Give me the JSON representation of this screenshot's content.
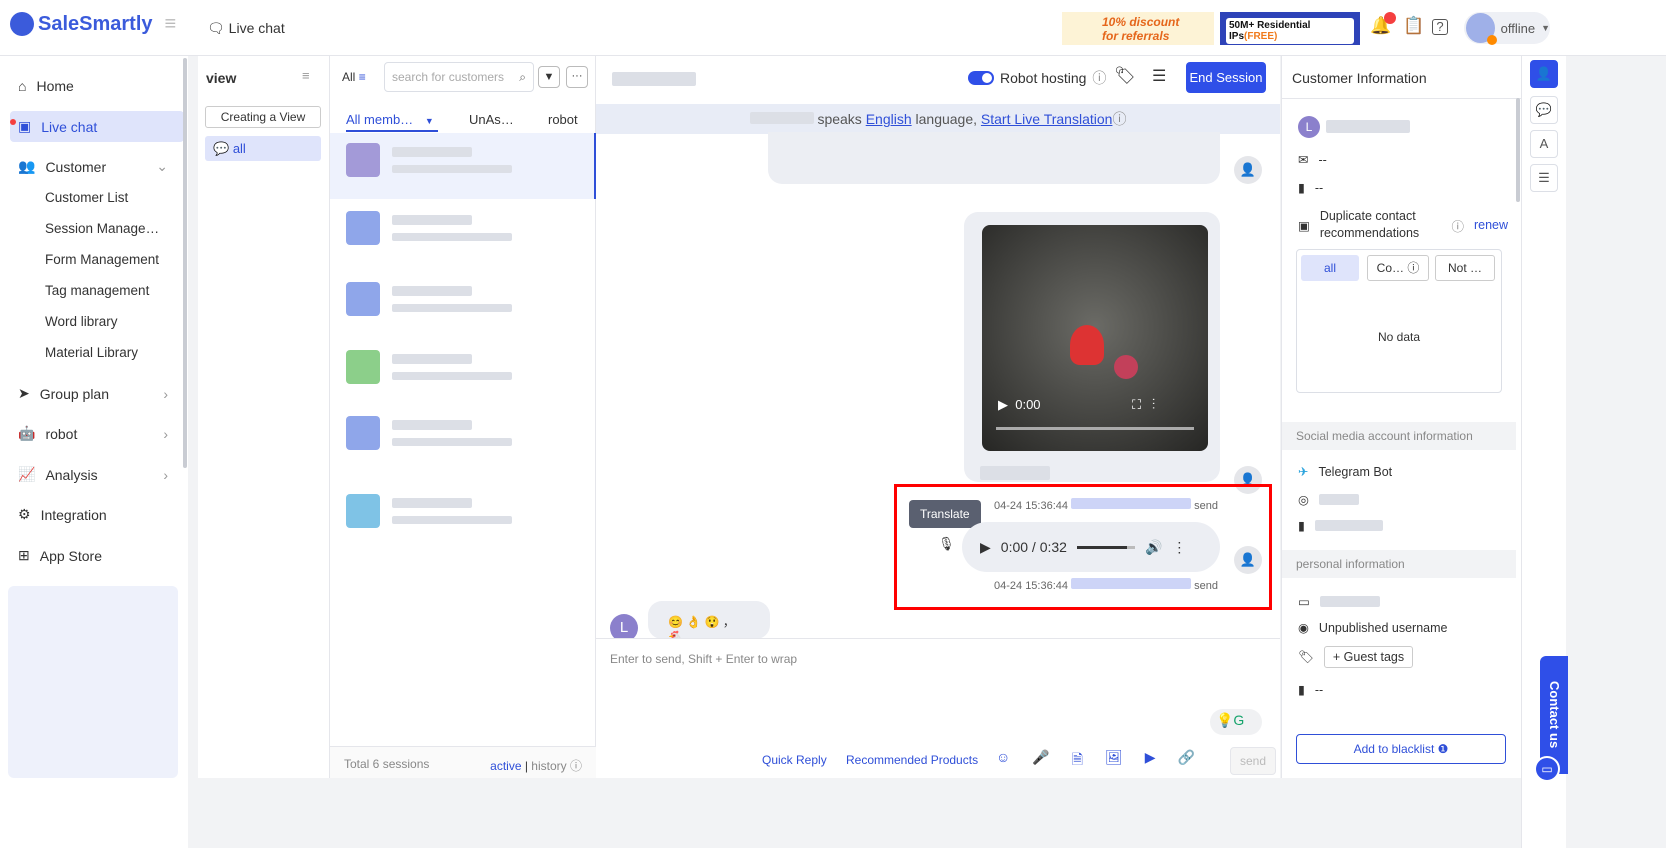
{
  "brand": "SaleSmartly",
  "header": {
    "page_title": "Live chat",
    "promo1_line1": "10% discount",
    "promo1_line2": "for referrals",
    "promo2_text": "50M+ Residential IPs",
    "promo2_free": "(FREE)",
    "notif_badge": "...",
    "status": "offline"
  },
  "sidebar": {
    "items": [
      {
        "label": "Home"
      },
      {
        "label": "Live chat"
      },
      {
        "label": "Customer"
      },
      {
        "label": "Group plan"
      },
      {
        "label": "robot"
      },
      {
        "label": "Analysis"
      },
      {
        "label": "Integration"
      },
      {
        "label": "App Store"
      }
    ],
    "customer_sub": [
      "Customer List",
      "Session Manage…",
      "Form Management",
      "Tag management",
      "Word library",
      "Material Library"
    ]
  },
  "view": {
    "title": "view",
    "create_label": "Creating a View",
    "all_label": "all"
  },
  "list": {
    "filter_all": "All",
    "search_placeholder": "search for customers",
    "tabs": [
      "All memb…",
      "UnAs…",
      "robot"
    ],
    "total": "Total 6 sessions",
    "active": "active",
    "history": "history"
  },
  "chat": {
    "robot_hosting": "Robot hosting",
    "end_session": "End Session",
    "translate_bar": {
      "speaks": "speaks",
      "language": "English",
      "suffix": "language,",
      "action": "Start Live Translation"
    },
    "video_time": "0:00",
    "tooltip": "Translate",
    "audio_time": "0:00 / 0:32",
    "messages": [
      {
        "time": "04-24 15:36:44",
        "status": "send"
      },
      {
        "time": "04-24 15:36:44",
        "status": "send"
      }
    ],
    "emoji_msg": "😊 👌 😲 ， 🐔",
    "avatar_letter": "L",
    "input_placeholder": "Enter to send, Shift + Enter to wrap",
    "toolbar": {
      "quick_reply": "Quick Reply",
      "recommended": "Recommended Products",
      "send": "send"
    }
  },
  "customer": {
    "title": "Customer Information",
    "avatar_letter": "L",
    "email": "--",
    "phone": "--",
    "duplicate": "Duplicate contact recommendations",
    "renew": "renew",
    "dup_tabs": [
      "all",
      "Co…",
      "Not …"
    ],
    "no_data": "No data",
    "social_title": "Social media account information",
    "telegram": "Telegram Bot",
    "personal_title": "personal information",
    "username": "Unpublished username",
    "guest_tags": "+ Guest tags",
    "last": "--",
    "blacklist": "Add to blacklist"
  },
  "contact_us": "Contact us",
  "colors": {
    "accent": "#2f4fe8",
    "highlight": "#ff0000"
  }
}
